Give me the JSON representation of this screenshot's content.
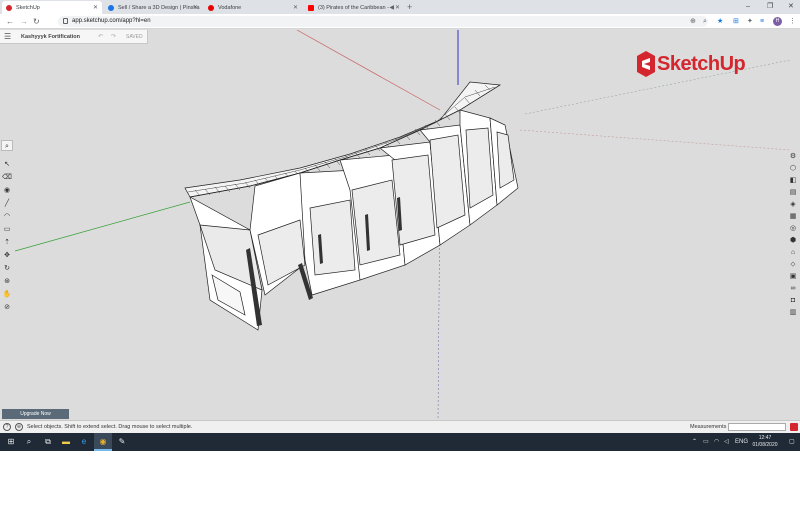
{
  "browser": {
    "tabs": [
      {
        "label": "SketchUp",
        "favicon_color": "#d4262f",
        "active": true
      },
      {
        "label": "Sell / Share a 3D Design | Pinsha",
        "favicon_color": "#1a73e8",
        "active": false
      },
      {
        "label": "Vodafone",
        "favicon_color": "#e60000",
        "active": false
      },
      {
        "label": "(3) Pirates of the Caribbean -",
        "favicon_color": "#ff0000",
        "active": false
      }
    ],
    "new_tab": "+",
    "window_controls": {
      "minimize": "–",
      "maximize": "❐",
      "close": "✕"
    },
    "nav": {
      "back": "←",
      "forward": "→",
      "reload": "↻"
    },
    "url": "app.sketchup.com/app?hl=en",
    "profile_initial": "H",
    "toolbar_icons": {
      "screen": "⊕",
      "zoom": "⌕",
      "star": "★",
      "ext": "⊞",
      "puzzle": "✦",
      "menu": "⋮"
    }
  },
  "sketchup": {
    "model_title": "Kashyyyk Fortification",
    "save_status": "SAVED",
    "undo": "↶",
    "redo": "↷",
    "logo_text": "SketchUp",
    "upgrade_label": "Upgrade Now",
    "left_tools": [
      "search-icon",
      "select-icon",
      "eraser-icon",
      "paint-bucket-icon",
      "line-icon",
      "arc-icon",
      "rectangle-icon",
      "push-pull-icon",
      "move-icon",
      "rotate-icon",
      "orbit-icon",
      "pan-icon",
      "tape-measure-icon",
      "section-icon"
    ],
    "right_tools": [
      "entity-info-icon",
      "components-icon",
      "materials-icon",
      "styles-icon",
      "layers-icon",
      "scenes-icon",
      "outliner-icon",
      "display-icon",
      "instructor-icon",
      "solid-inspector-icon",
      "views-icon",
      "shadows-icon",
      "3d-warehouse-icon",
      "extensions-icon"
    ],
    "status": {
      "message": "Select objects. Shift to extend select. Drag mouse to select multiple.",
      "measurements_label": "Measurements",
      "measurements_value": ""
    }
  },
  "taskbar": {
    "time": "12:47",
    "date": "01/08/2020",
    "language": "ENG"
  },
  "colors": {
    "brand_red": "#d4262f",
    "canvas_bg": "#dcdcdc",
    "axis_red": "#c84040",
    "axis_green": "#3aa03a",
    "axis_blue": "#3030c8"
  }
}
